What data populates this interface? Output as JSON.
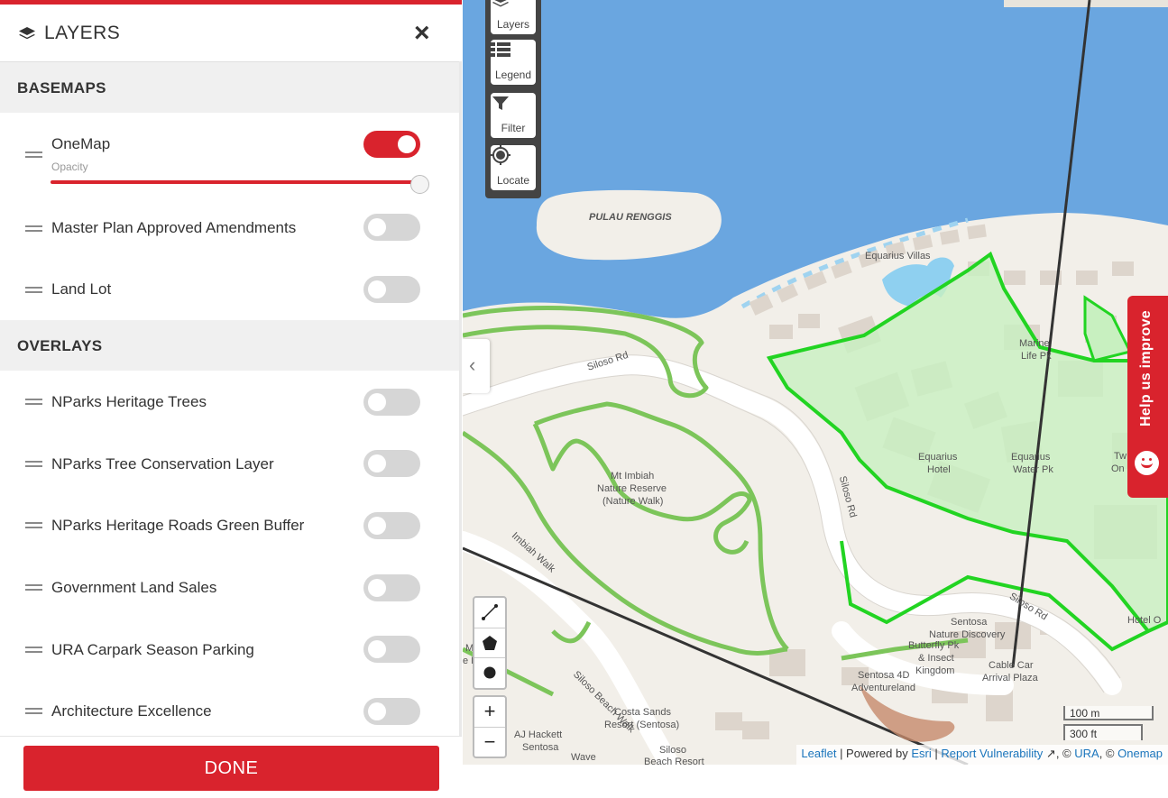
{
  "panel": {
    "title": "LAYERS",
    "close": "×",
    "basemaps_heading": "BASEMAPS",
    "overlays_heading": "OVERLAYS",
    "opacity_label": "Opacity",
    "opacity_value": 1.0,
    "basemaps": [
      {
        "label": "OneMap",
        "enabled": true
      },
      {
        "label": "Master Plan Approved Amendments",
        "enabled": false
      },
      {
        "label": "Land Lot",
        "enabled": false
      }
    ],
    "overlays": [
      {
        "label": "NParks Heritage Trees",
        "enabled": false
      },
      {
        "label": "NParks Tree Conservation Layer",
        "enabled": false
      },
      {
        "label": "NParks Heritage Roads Green Buffer",
        "enabled": false
      },
      {
        "label": "Government Land Sales",
        "enabled": false
      },
      {
        "label": "URA Carpark Season Parking",
        "enabled": false
      },
      {
        "label": "Architecture Excellence",
        "enabled": false
      }
    ],
    "done_label": "DONE"
  },
  "map_controls": {
    "layers": "Layers",
    "legend": "Legend",
    "filter": "Filter",
    "locate": "Locate",
    "zoom_in": "+",
    "zoom_out": "−",
    "collapse": "‹"
  },
  "map_labels": {
    "island": "PULAU RENGGIS",
    "equarius_villas": "Equarius Villas",
    "siloso_rd_1": "Siloso Rd",
    "siloso_rd_2": "Siloso Rd",
    "siloso_rd_3": "Siloso Rd",
    "imbiah_walk": "Imbiah Walk",
    "siloso_beach_walk": "Siloso Beach Walk",
    "mt_imbiah_1": "Mt Imbiah",
    "mt_imbiah_2": "Nature Reserve",
    "mt_imbiah_3": "(Nature Walk)",
    "marine_life_1": "Marine",
    "marine_life_2": "Life Pk",
    "equarius_hotel_1": "Equarius",
    "equarius_hotel_2": "Hotel",
    "equarius_water_1": "Equarius",
    "equarius_water_2": "Water Pk",
    "tw_1": "Tw",
    "tw_2": "On",
    "hotel_o": "Hotel O",
    "sentosa_nd_1": "Sentosa",
    "sentosa_nd_2": "Nature Discovery",
    "butterfly_1": "Butterfly Pk",
    "butterfly_2": "& Insect",
    "butterfly_3": "Kingdom",
    "sentosa4d_1": "Sentosa 4D",
    "sentosa4d_2": "Adventureland",
    "cablecar_1": "Cable Car",
    "cablecar_2": "Arrival Plaza",
    "costa_1": "Costa Sands",
    "costa_2": "Resort (Sentosa)",
    "ajh_1": "AJ Hackett",
    "ajh_2": "Sentosa",
    "siloso_beach_1": "Siloso",
    "siloso_beach_2": "Beach Resort",
    "wave": "Wave",
    "edge_m": "M",
    "edge_pk": "e Pk"
  },
  "scale": {
    "metric": "100 m",
    "imperial": "300 ft"
  },
  "attribution": {
    "leaflet": "Leaflet",
    "powered_by": " | Powered by ",
    "esri": "Esri",
    "sep": " | ",
    "report": "Report Vulnerability",
    "ext_icon": "↗",
    "copy_ura": ", © ",
    "ura": "URA",
    "copy_onemap": ", © ",
    "onemap": "Onemap"
  },
  "help_tab": {
    "label": "Help us improve"
  },
  "colors": {
    "accent": "#d9232d",
    "water": "#6aa6e0",
    "land": "#f2efe9",
    "park_outline": "#22d422",
    "park_fill": "#c8f0c0",
    "trail": "#7cc55a"
  }
}
